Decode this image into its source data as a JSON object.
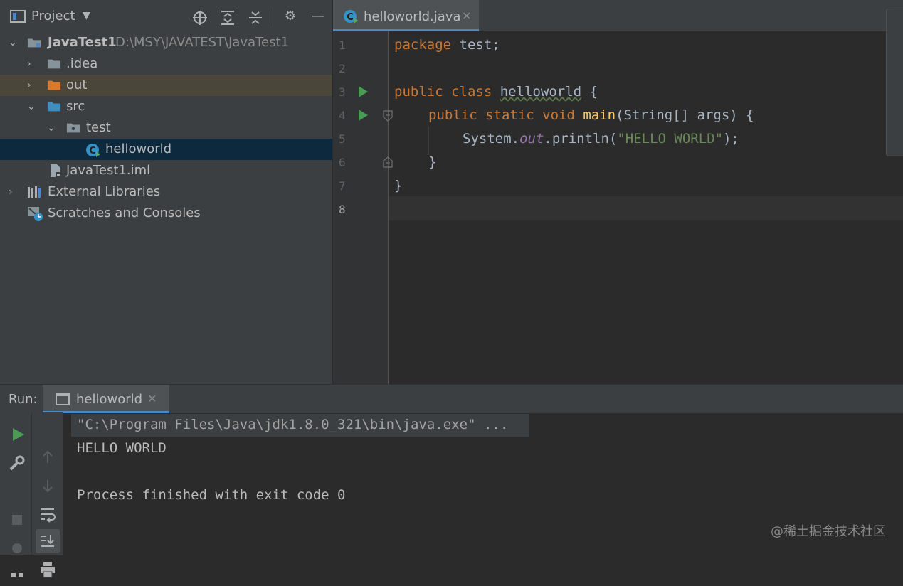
{
  "project_panel": {
    "title": "Project",
    "toolbar_icons": [
      "locate-icon",
      "expand-all-icon",
      "collapse-all-icon",
      "gear-icon",
      "minimize-icon"
    ],
    "tree": [
      {
        "label": "JavaTest1",
        "path": "D:\\MSY\\JAVATEST\\JavaTest1",
        "expanded": true,
        "icon": "module-folder-icon"
      },
      {
        "label": ".idea",
        "expanded": false,
        "icon": "folder-icon"
      },
      {
        "label": "out",
        "expanded": false,
        "icon": "excluded-folder-icon"
      },
      {
        "label": "src",
        "expanded": true,
        "icon": "source-folder-icon"
      },
      {
        "label": "test",
        "expanded": true,
        "icon": "package-icon"
      },
      {
        "label": "helloworld",
        "icon": "java-class-icon",
        "selected": true
      },
      {
        "label": "JavaTest1.iml",
        "icon": "iml-file-icon"
      },
      {
        "label": "External Libraries",
        "expanded": false,
        "icon": "libraries-icon"
      },
      {
        "label": "Scratches and Consoles",
        "icon": "scratches-icon"
      }
    ]
  },
  "editor": {
    "tab_label": "helloworld.java",
    "line_numbers": [
      "1",
      "2",
      "3",
      "4",
      "5",
      "6",
      "7",
      "8"
    ],
    "code": {
      "l1_kw": "package",
      "l1_rest": " test;",
      "l3_kw": "public class",
      "l3_name": "helloworld",
      "l3_rest": " {",
      "l4_kw": "public static void",
      "l4_fn": "main",
      "l4_rest": "(String[] args) {",
      "l5_a": "System.",
      "l5_field": "out",
      "l5_b": ".println(",
      "l5_str": "\"HELLO WORLD\"",
      "l5_c": ");",
      "l6": "}",
      "l7": "}"
    }
  },
  "run_panel": {
    "label": "Run:",
    "tab_label": "helloworld",
    "console": [
      "\"C:\\Program Files\\Java\\jdk1.8.0_321\\bin\\java.exe\" ...",
      "HELLO WORLD",
      "",
      "Process finished with exit code 0"
    ]
  },
  "watermark": "@稀土掘金技术社区",
  "colors": {
    "keyword": "#cc7832",
    "function": "#ffc66d",
    "string": "#6a8759",
    "field": "#9876aa",
    "selection": "#0d293e",
    "run_green": "#499c54"
  }
}
